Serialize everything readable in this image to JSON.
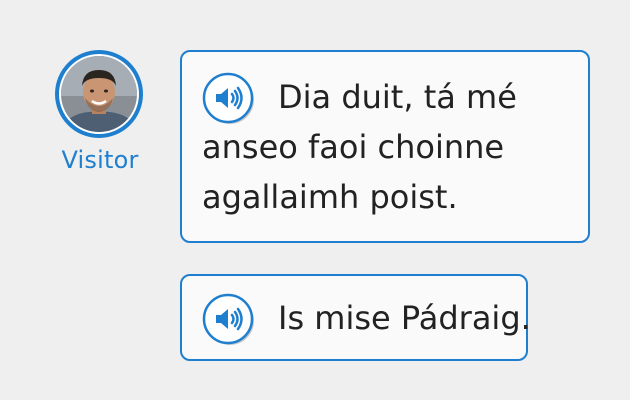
{
  "conversation": {
    "speaker": {
      "label": "Visitor",
      "avatar_icon": "person-photo-avatar",
      "accent_color": "#1f7fcf"
    },
    "messages": [
      {
        "lines": [
          "Dia duit, tá mé",
          "anseo faoi choinne",
          "agallaimh poist."
        ],
        "audio_icon": "speaker-icon"
      },
      {
        "text": "Is mise Pádraig.",
        "audio_icon": "speaker-icon"
      }
    ]
  }
}
